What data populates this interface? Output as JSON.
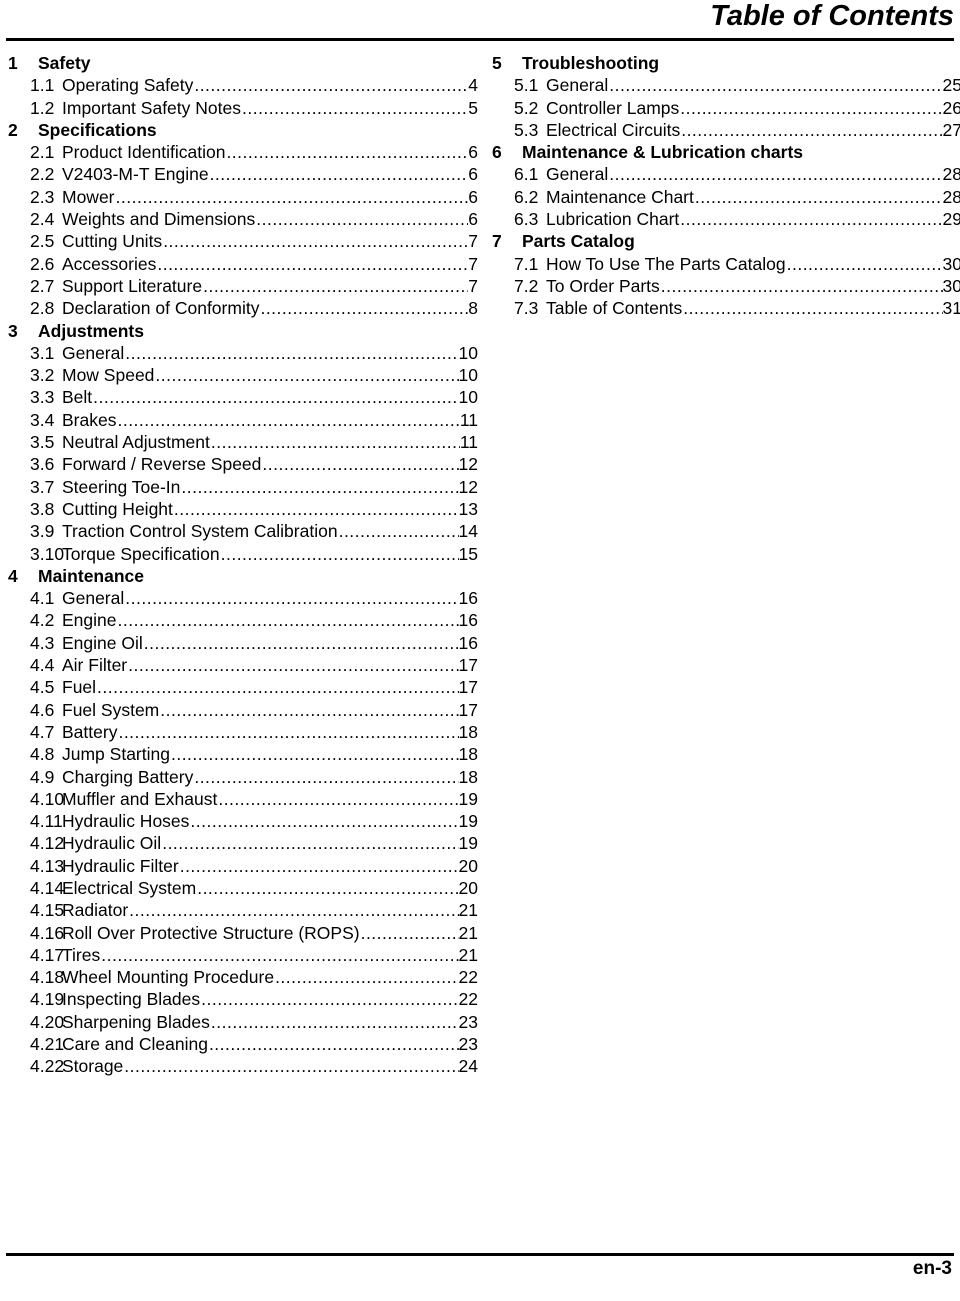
{
  "header": {
    "title": "Table of Contents"
  },
  "footer": {
    "page_label": "en-3"
  },
  "leader_dots": "...........................................................................................................................",
  "columns": [
    {
      "id": "left",
      "entries": [
        {
          "type": "chapter",
          "num": "1",
          "label": "Safety",
          "page": ""
        },
        {
          "type": "section",
          "num": "1.1",
          "label": "Operating Safety",
          "page": "4"
        },
        {
          "type": "section",
          "num": "1.2",
          "label": "Important Safety Notes",
          "page": "5"
        },
        {
          "type": "chapter",
          "num": "2",
          "label": "Specifications",
          "page": ""
        },
        {
          "type": "section",
          "num": "2.1",
          "label": "Product Identification",
          "page": "6"
        },
        {
          "type": "section",
          "num": "2.2",
          "label": "V2403-M-T Engine",
          "page": "6"
        },
        {
          "type": "section",
          "num": "2.3",
          "label": "Mower",
          "page": "6"
        },
        {
          "type": "section",
          "num": "2.4",
          "label": "Weights and Dimensions",
          "page": "6"
        },
        {
          "type": "section",
          "num": "2.5",
          "label": "Cutting Units",
          "page": "7"
        },
        {
          "type": "section",
          "num": "2.6",
          "label": "Accessories",
          "page": "7"
        },
        {
          "type": "section",
          "num": "2.7",
          "label": "Support Literature",
          "page": "7"
        },
        {
          "type": "section",
          "num": "2.8",
          "label": "Declaration of Conformity",
          "page": "8"
        },
        {
          "type": "chapter",
          "num": "3",
          "label": "Adjustments",
          "page": ""
        },
        {
          "type": "section",
          "num": "3.1",
          "label": "General",
          "page": "10"
        },
        {
          "type": "section",
          "num": "3.2",
          "label": "Mow Speed",
          "page": "10"
        },
        {
          "type": "section",
          "num": "3.3",
          "label": "Belt",
          "page": "10"
        },
        {
          "type": "section",
          "num": "3.4",
          "label": "Brakes",
          "page": "11"
        },
        {
          "type": "section",
          "num": "3.5",
          "label": "Neutral Adjustment",
          "page": "11"
        },
        {
          "type": "section",
          "num": "3.6",
          "label": "Forward / Reverse Speed",
          "page": "12"
        },
        {
          "type": "section",
          "num": "3.7",
          "label": "Steering Toe-In",
          "page": "12"
        },
        {
          "type": "section",
          "num": "3.8",
          "label": "Cutting Height",
          "page": "13"
        },
        {
          "type": "section",
          "num": "3.9",
          "label": "Traction Control System Calibration",
          "page": "14"
        },
        {
          "type": "section",
          "num": "3.10",
          "label": "Torque Specification",
          "page": "15"
        },
        {
          "type": "chapter",
          "num": "4",
          "label": "Maintenance",
          "page": ""
        },
        {
          "type": "section",
          "num": "4.1",
          "label": "General",
          "page": "16"
        },
        {
          "type": "section",
          "num": "4.2",
          "label": "Engine",
          "page": "16"
        },
        {
          "type": "section",
          "num": "4.3",
          "label": "Engine Oil",
          "page": "16"
        },
        {
          "type": "section",
          "num": "4.4",
          "label": "Air Filter",
          "page": "17"
        },
        {
          "type": "section",
          "num": "4.5",
          "label": "Fuel",
          "page": "17"
        },
        {
          "type": "section",
          "num": "4.6",
          "label": "Fuel System",
          "page": "17"
        },
        {
          "type": "section",
          "num": "4.7",
          "label": "Battery",
          "page": "18"
        },
        {
          "type": "section",
          "num": "4.8",
          "label": "Jump Starting",
          "page": "18"
        },
        {
          "type": "section",
          "num": "4.9",
          "label": "Charging Battery",
          "page": "18"
        },
        {
          "type": "section",
          "num": "4.10",
          "label": "Muffler and Exhaust",
          "page": "19"
        },
        {
          "type": "section",
          "num": "4.11",
          "label": "Hydraulic Hoses",
          "page": "19"
        },
        {
          "type": "section",
          "num": "4.12",
          "label": "Hydraulic Oil",
          "page": "19"
        },
        {
          "type": "section",
          "num": "4.13",
          "label": "Hydraulic Filter",
          "page": "20"
        },
        {
          "type": "section",
          "num": "4.14",
          "label": "Electrical System",
          "page": "20"
        },
        {
          "type": "section",
          "num": "4.15",
          "label": "Radiator",
          "page": "21"
        },
        {
          "type": "section",
          "num": "4.16",
          "label": "Roll Over Protective Structure (ROPS)",
          "page": "21"
        },
        {
          "type": "section",
          "num": "4.17",
          "label": "Tires",
          "page": "21"
        },
        {
          "type": "section",
          "num": "4.18",
          "label": "Wheel Mounting Procedure",
          "page": "22"
        },
        {
          "type": "section",
          "num": "4.19",
          "label": "Inspecting Blades",
          "page": "22"
        },
        {
          "type": "section",
          "num": "4.20",
          "label": "Sharpening Blades",
          "page": "23"
        },
        {
          "type": "section",
          "num": "4.21",
          "label": "Care and Cleaning",
          "page": "23"
        },
        {
          "type": "section",
          "num": "4.22",
          "label": "Storage",
          "page": "24"
        }
      ]
    },
    {
      "id": "right",
      "entries": [
        {
          "type": "chapter",
          "num": "5",
          "label": "Troubleshooting",
          "page": ""
        },
        {
          "type": "section",
          "num": "5.1",
          "label": "General",
          "page": "25"
        },
        {
          "type": "section",
          "num": "5.2",
          "label": "Controller Lamps",
          "page": "26"
        },
        {
          "type": "section",
          "num": "5.3",
          "label": "Electrical Circuits",
          "page": "27"
        },
        {
          "type": "chapter",
          "num": "6",
          "label": "Maintenance & Lubrication charts",
          "page": ""
        },
        {
          "type": "section",
          "num": "6.1",
          "label": "General",
          "page": "28"
        },
        {
          "type": "section",
          "num": "6.2",
          "label": "Maintenance Chart",
          "page": "28"
        },
        {
          "type": "section",
          "num": "6.3",
          "label": "Lubrication Chart",
          "page": "29"
        },
        {
          "type": "chapter",
          "num": "7",
          "label": "Parts Catalog",
          "page": ""
        },
        {
          "type": "section",
          "num": "7.1",
          "label": "How To Use The Parts Catalog",
          "page": "30"
        },
        {
          "type": "section",
          "num": "7.2",
          "label": "To Order Parts",
          "page": "30"
        },
        {
          "type": "section",
          "num": "7.3",
          "label": "Table of Contents",
          "page": "31"
        }
      ]
    }
  ]
}
